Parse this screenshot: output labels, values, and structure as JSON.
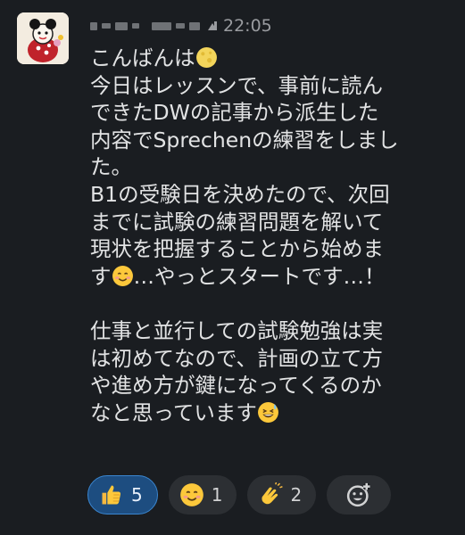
{
  "message": {
    "sender_blurred": true,
    "timestamp": "22:05",
    "line1": "こんばんは",
    "text": "今日はレッスンで、事前に読ん\nできたDWの記事から派生した\n内容でSprechenの練習をしまし\nた。\nB1の受験日を決めたので、次回\nまでに試験の練習問題を解いて\n現状を把握することから始めま\nす",
    "text_after_smile": "…やっとスタートです…！",
    "paragraph2": "仕事と並行しての試験勉強は実\nは初めてなので、計画の立て方\nや進め方が鍵になってくるのか\nなと思っています"
  },
  "reactions": [
    {
      "emoji": "thumbs-up",
      "count": "5",
      "active": true
    },
    {
      "emoji": "smiling-face",
      "count": "1",
      "active": false
    },
    {
      "emoji": "clapping-hands",
      "count": "2",
      "active": false
    }
  ],
  "icons": {
    "inline_1": "crescent-moon-emoji",
    "inline_2": "smiling-face-emoji",
    "inline_3": "grinning-sweat-emoji",
    "add_reaction": "add-reaction-icon"
  },
  "colors": {
    "background": "#1a1d21",
    "active_reaction_bg": "#1d4d80",
    "active_reaction_border": "#3a86d0"
  }
}
